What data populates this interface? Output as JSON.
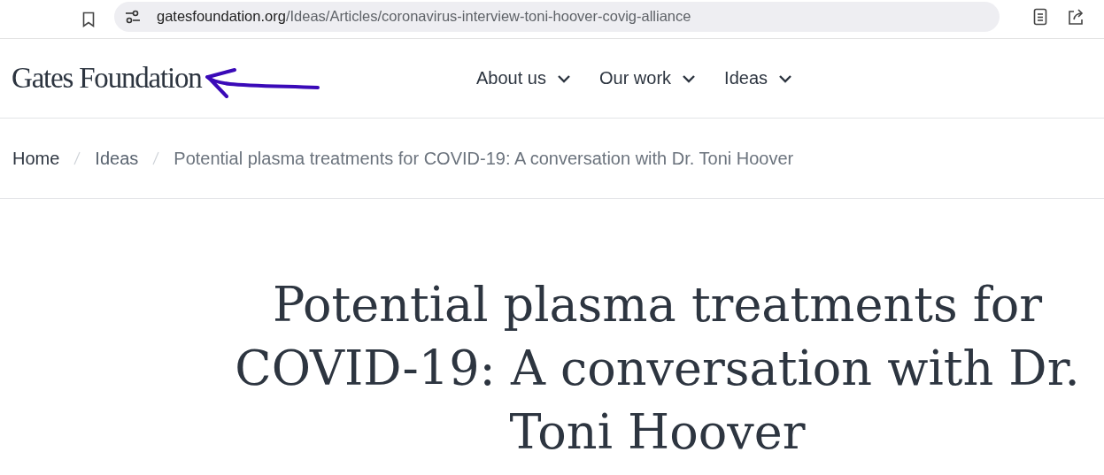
{
  "browser": {
    "url_domain": "gatesfoundation.org",
    "url_path": "/Ideas/Articles/coronavirus-interview-toni-hoover-covig-alliance"
  },
  "header": {
    "logo": "Gates Foundation",
    "annotation": {
      "kind": "arrow"
    },
    "nav": [
      {
        "label": "About us"
      },
      {
        "label": "Our work"
      },
      {
        "label": "Ideas"
      }
    ]
  },
  "breadcrumb": [
    {
      "label": "Home",
      "kind": "root"
    },
    {
      "label": "Ideas",
      "kind": "link"
    },
    {
      "label": "Potential plasma treatments for COVID-19: A conversation with Dr. Toni Hoover",
      "kind": "current"
    }
  ],
  "article": {
    "title": "Potential plasma treatments for COVID-19: A conversation with Dr. Toni Hoover"
  }
}
